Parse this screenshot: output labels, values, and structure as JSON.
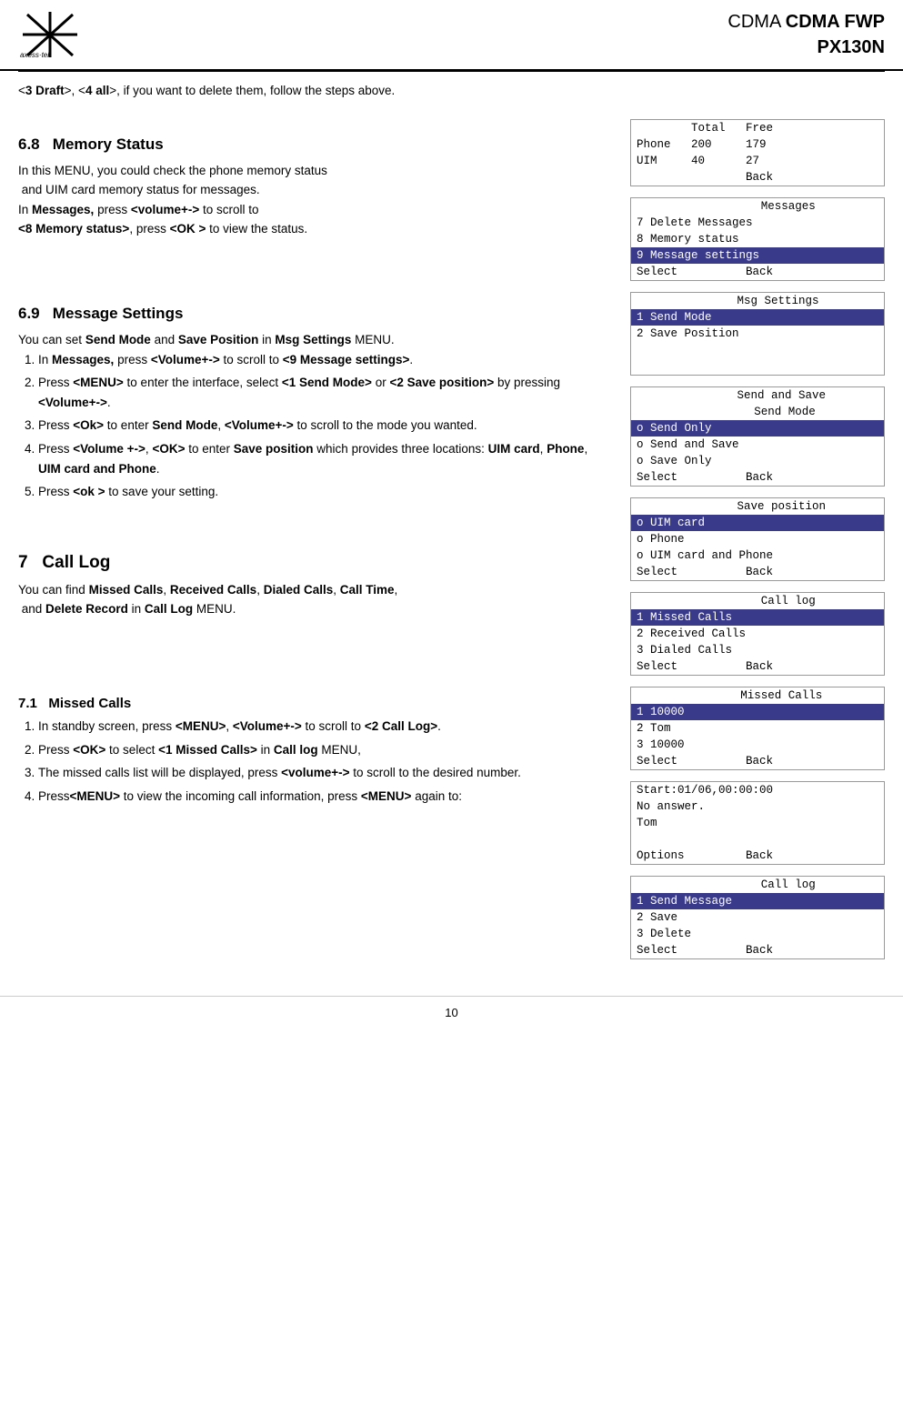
{
  "header": {
    "brand": "axess·tel",
    "title_line1": "CDMA FWP",
    "title_line2": "PX130N"
  },
  "intro": {
    "text": "<3 Draft>, <4 all>, if you want to delete them, follow the steps above."
  },
  "sections": [
    {
      "id": "6.8",
      "title": "6.8   Memory Status",
      "body": "In this MENU, you could check the phone memory status and UIM card memory status for messages.\nIn Messages, press <volume+-> to scroll to <8 Memory status>, press <OK > to view the status."
    },
    {
      "id": "6.9",
      "title": "6.9   Message Settings",
      "body": "You can set Send Mode and Save Position in Msg Settings MENU."
    },
    {
      "id": "7",
      "title": "7   Call Log",
      "body": "You can find Missed Calls, Received Calls, Dialed Calls, Call Time, and Delete Record in Call Log MENU."
    },
    {
      "id": "7.1",
      "title": "7.1   Missed Calls",
      "steps": [
        "In standby screen, press <MENU>, <Volume+-> to scroll to <2 Call Log>.",
        "Press <OK> to select <1 Missed Calls> in Call log MENU,",
        "The missed calls list will be displayed, press <volume+-> to scroll to the desired number.",
        "Press<MENU> to view the incoming call information, press <MENU> again to:"
      ]
    }
  ],
  "msg_settings_steps": [
    "In Messages, press <Volume+-> to scroll to <9 Message settings>.",
    "Press <MENU> to enter the interface, select <1 Send Mode> or <2 Save position> by pressing <Volume+->.",
    "Press <Ok> to enter Send Mode, <Volume+-> to scroll to the mode you wanted.",
    "Press <Volume +->, <OK> to enter Save position which provides three locations: UIM card, Phone, UIM card and Phone.",
    "Press <ok > to save your setting."
  ],
  "screens": {
    "memory_status": {
      "rows": [
        {
          "text": "        Total   Free",
          "style": "normal"
        },
        {
          "text": "Phone   200     179",
          "style": "normal"
        },
        {
          "text": "UIM     40      27",
          "style": "normal"
        },
        {
          "text": "                Back",
          "style": "normal"
        }
      ]
    },
    "messages_menu": {
      "rows": [
        {
          "text": "         Messages",
          "style": "normal"
        },
        {
          "text": "7 Delete Messages",
          "style": "normal"
        },
        {
          "text": "8 Memory status",
          "style": "normal"
        },
        {
          "text": "9 Message settings",
          "style": "highlighted"
        },
        {
          "text": "Select          Back",
          "style": "normal"
        }
      ]
    },
    "msg_settings": {
      "rows": [
        {
          "text": "      Msg Settings",
          "style": "normal"
        },
        {
          "text": "1 Send Mode",
          "style": "highlighted"
        },
        {
          "text": "2 Save Position",
          "style": "normal"
        },
        {
          "text": "",
          "style": "normal"
        },
        {
          "text": "",
          "style": "normal"
        }
      ]
    },
    "send_and_save": {
      "rows": [
        {
          "text": "       Send and Save",
          "style": "normal"
        },
        {
          "text": "       Send Mode",
          "style": "normal"
        },
        {
          "text": "o Send Only",
          "style": "highlighted"
        },
        {
          "text": "o Send and Save",
          "style": "normal"
        },
        {
          "text": "o Save Only",
          "style": "normal"
        },
        {
          "text": "Select          Back",
          "style": "normal"
        }
      ]
    },
    "save_position": {
      "rows": [
        {
          "text": "       Save position",
          "style": "normal"
        },
        {
          "text": "o UIM card",
          "style": "highlighted"
        },
        {
          "text": "o Phone",
          "style": "normal"
        },
        {
          "text": "o UIM card and Phone",
          "style": "normal"
        },
        {
          "text": "Select          Back",
          "style": "normal"
        }
      ]
    },
    "call_log": {
      "rows": [
        {
          "text": "         Call log",
          "style": "normal"
        },
        {
          "text": "1 Missed Calls",
          "style": "highlighted"
        },
        {
          "text": "2 Received Calls",
          "style": "normal"
        },
        {
          "text": "3 Dialed Calls",
          "style": "normal"
        },
        {
          "text": "Select          Back",
          "style": "normal"
        }
      ]
    },
    "missed_calls": {
      "rows": [
        {
          "text": "       Missed Calls",
          "style": "normal"
        },
        {
          "text": "1 10000",
          "style": "highlighted"
        },
        {
          "text": "2 Tom",
          "style": "normal"
        },
        {
          "text": "3 10000",
          "style": "normal"
        },
        {
          "text": "Select          Back",
          "style": "normal"
        }
      ]
    },
    "call_detail": {
      "rows": [
        {
          "text": "Start:01/06,00:00:00",
          "style": "normal"
        },
        {
          "text": "No answer.",
          "style": "normal"
        },
        {
          "text": "Tom",
          "style": "normal"
        },
        {
          "text": "",
          "style": "normal"
        },
        {
          "text": "Options         Back",
          "style": "normal"
        }
      ]
    },
    "call_log_options": {
      "rows": [
        {
          "text": "         Call log",
          "style": "normal"
        },
        {
          "text": "1 Send Message",
          "style": "highlighted"
        },
        {
          "text": "2 Save",
          "style": "normal"
        },
        {
          "text": "3 Delete",
          "style": "normal"
        },
        {
          "text": "Select          Back",
          "style": "normal"
        }
      ]
    }
  },
  "footer": {
    "page_number": "10"
  }
}
